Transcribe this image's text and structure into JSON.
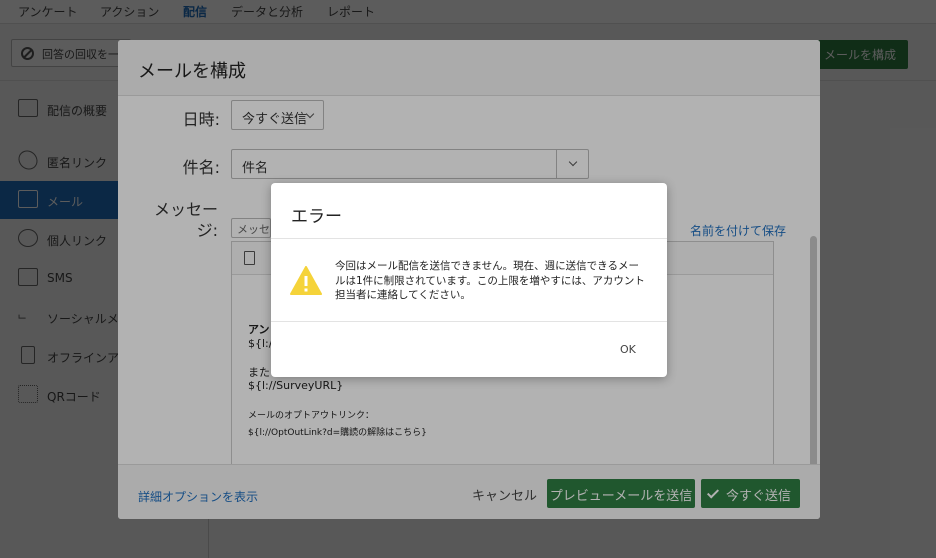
{
  "top_nav": {
    "tabs": [
      "アンケート",
      "アクション",
      "配信",
      "データと分析",
      "レポート"
    ],
    "active_index": 2
  },
  "toolbar": {
    "stop_label": "回答の回収を一",
    "compose_label": "メールを構成"
  },
  "sidebar": {
    "items": [
      {
        "label": "配信の概要",
        "icon": "list-icon"
      },
      {
        "label": "匿名リンク",
        "icon": "link-icon"
      },
      {
        "label": "メール",
        "icon": "envelope-icon"
      },
      {
        "label": "個人リンク",
        "icon": "fingerprint-icon"
      },
      {
        "label": "SMS",
        "icon": "chat-icon"
      },
      {
        "label": "ソーシャルメ",
        "icon": "share-icon"
      },
      {
        "label": "オフラインア",
        "icon": "tablet-icon"
      },
      {
        "label": "QRコード",
        "icon": "qr-icon"
      }
    ],
    "active_index": 2
  },
  "compose": {
    "title": "メールを構成",
    "datetime_label": "日時:",
    "datetime_value": "今すぐ送信",
    "subject_label": "件名:",
    "subject_value": "件名",
    "message_label_1": "メッセー",
    "message_label_2": "ジ:",
    "message_type": "メッセ",
    "save_as_label": "名前を付けて保存",
    "editor_lines": {
      "line1": "アン",
      "line2": "${l://",
      "line3": "また",
      "line4": "${l://SurveyURL}",
      "line5": "メールのオプトアウトリンク：",
      "line6": "${l://OptOutLink?d=購読の解除はこちら}"
    },
    "advanced_link": "詳細オプションを表示",
    "cancel_label": "キャンセル",
    "preview_label": "プレビューメールを送信",
    "send_now_label": "今すぐ送信"
  },
  "error_dialog": {
    "title": "エラー",
    "message": "今回はメール配信を送信できません。現在、週に送信できるメールは1件に制限されています。この上限を増やすには、アカウント担当者に連絡してください。",
    "ok_label": "OK",
    "icon": "warning-icon"
  },
  "colors": {
    "brand_green": "#2e7d42",
    "link_blue": "#1f6fbf",
    "warning_yellow": "#f5d33a"
  }
}
